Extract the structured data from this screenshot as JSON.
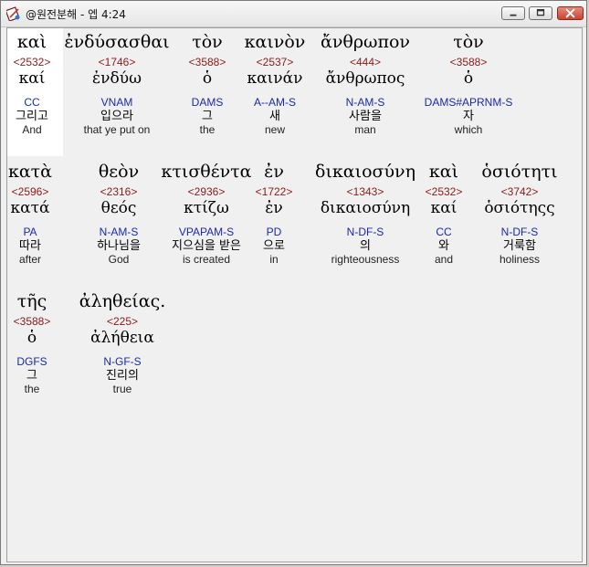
{
  "window": {
    "title": "@원전분해 - 엡 4:24",
    "controls": {
      "minimize": "minimize",
      "maximize": "maximize",
      "close": "close"
    },
    "icon": "bible-interlinear-app-icon"
  },
  "colors": {
    "strong": "#8b1a1a",
    "parse": "#1a2aa8",
    "highlight": "#ffffff"
  },
  "rows": [
    [
      {
        "greek": "καὶ",
        "strong": "<2532>",
        "lemma": "καί",
        "parse": "CC",
        "kor": "그리고",
        "eng": "And"
      },
      {
        "greek": "ἐνδύσασθαι",
        "strong": "<1746>",
        "lemma": "ἐνδύω",
        "parse": "VNAM",
        "kor": "입으라",
        "eng": "that ye put on"
      },
      {
        "greek": "τὸν",
        "strong": "<3588>",
        "lemma": "ὁ",
        "parse": "DAMS",
        "kor": "그",
        "eng": "the"
      },
      {
        "greek": "καινὸν",
        "strong": "<2537>",
        "lemma": "καινάν",
        "parse": "A--AM-S",
        "kor": "새",
        "eng": "new"
      },
      {
        "greek": "ἄνθρωπον",
        "strong": "<444>",
        "lemma": "ἄνθρωπος",
        "parse": "N-AM-S",
        "kor": "사람을",
        "eng": "man"
      },
      {
        "greek": "τὸν",
        "strong": "<3588>",
        "lemma": "ὁ",
        "parse": "DAMS#APRNM-S",
        "kor": "자",
        "eng": "which"
      }
    ],
    [
      {
        "greek": "κατὰ",
        "strong": "<2596>",
        "lemma": "κατά",
        "parse": "PA",
        "kor": "따라",
        "eng": "after"
      },
      {
        "greek": "θεὸν",
        "strong": "<2316>",
        "lemma": "θεός",
        "parse": "N-AM-S",
        "kor": "하나님을",
        "eng": "God"
      },
      {
        "greek": "κτισθέντα",
        "strong": "<2936>",
        "lemma": "κτίζω",
        "parse": "VPAPAM-S",
        "kor": "지으심을 받은",
        "eng": "is created"
      },
      {
        "greek": "ἐν",
        "strong": "<1722>",
        "lemma": "ἐν",
        "parse": "PD",
        "kor": "으로",
        "eng": "in"
      },
      {
        "greek": "δικαιοσύνη",
        "strong": "<1343>",
        "lemma": "δικαιοσύνη",
        "parse": "N-DF-S",
        "kor": "의",
        "eng": "righteousness"
      },
      {
        "greek": "καὶ",
        "strong": "<2532>",
        "lemma": "καί",
        "parse": "CC",
        "kor": "와",
        "eng": "and"
      },
      {
        "greek": "ὁσιότητι",
        "strong": "<3742>",
        "lemma": "ὁσιότηςς",
        "parse": "N-DF-S",
        "kor": "거룩함",
        "eng": "holiness"
      }
    ],
    [
      {
        "greek": "τῆς",
        "strong": "<3588>",
        "lemma": "ὁ",
        "parse": "DGFS",
        "kor": "그",
        "eng": "the"
      },
      {
        "greek": "ἀληθείας.",
        "strong": "<225>",
        "lemma": "ἀλήθεια",
        "parse": "N-GF-S",
        "kor": "진리의",
        "eng": "true"
      }
    ]
  ]
}
